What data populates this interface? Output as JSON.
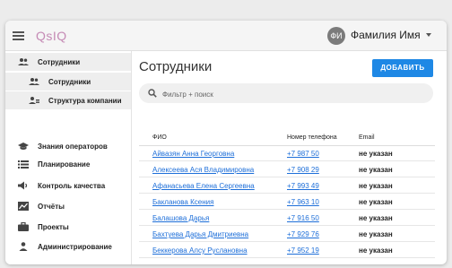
{
  "header": {
    "logo": "QsIQ",
    "avatar_initials": "ФИ",
    "user_name": "Фамилия Имя"
  },
  "sidebar": {
    "items": [
      {
        "label": "Сотрудники",
        "icon": "people-icon"
      },
      {
        "label": "Сотрудники",
        "icon": "people-icon"
      },
      {
        "label": "Структура компании",
        "icon": "hierarchy-icon"
      },
      {
        "label": "Знания операторов",
        "icon": "graduation-cap-icon"
      },
      {
        "label": "Планирование",
        "icon": "list-icon"
      },
      {
        "label": "Контроль качества",
        "icon": "speaker-icon"
      },
      {
        "label": "Отчёты",
        "icon": "chart-icon"
      },
      {
        "label": "Проекты",
        "icon": "briefcase-icon"
      },
      {
        "label": "Администрирование",
        "icon": "person-icon"
      }
    ]
  },
  "main": {
    "title": "Сотрудники",
    "add_button": "ДОБАВИТЬ",
    "search_placeholder": "Фильтр + поиск",
    "columns": [
      "ФИО",
      "Номер телефона",
      "Email"
    ],
    "rows": [
      {
        "name": "Айвазян Анна Георговна",
        "phone": "+7 987 50",
        "email": "не указан"
      },
      {
        "name": "Алексеева Ася Владимировна",
        "phone": "+7 908 29",
        "email": "не указан"
      },
      {
        "name": "Афанасьева Елена Сергеевна",
        "phone": "+7 993 49",
        "email": "не указан"
      },
      {
        "name": "Бакланова Ксения",
        "phone": "+7 963 10",
        "email": "не указан"
      },
      {
        "name": "Балашова Дарья",
        "phone": "+7 916 50",
        "email": "не указан"
      },
      {
        "name": "Бахтуева Дарья Дмитриевна",
        "phone": "+7 929 76",
        "email": "не указан"
      },
      {
        "name": "Беккерова Алсу Руслановна",
        "phone": "+7 952 19",
        "email": "не указан"
      }
    ]
  },
  "colors": {
    "accent": "#1e88e5",
    "link": "#1e6fd9",
    "logo": "#c58ab5"
  }
}
